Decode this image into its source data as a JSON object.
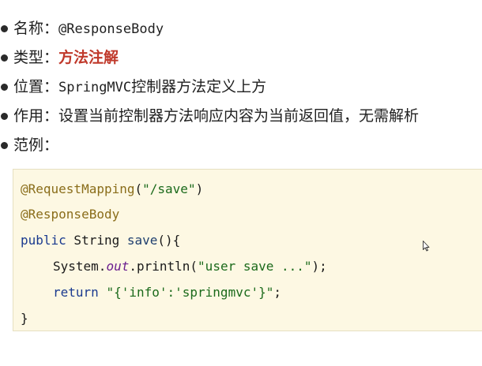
{
  "items": {
    "name": {
      "label": "名称：",
      "value": "@ResponseBody"
    },
    "type": {
      "label": "类型：",
      "value": "方法注解"
    },
    "position": {
      "label": "位置：",
      "value_code": "SpringMVC",
      "value_text": "控制器方法定义上方"
    },
    "usage": {
      "label": "作用：",
      "value": "设置当前控制器方法响应内容为当前返回值，无需解析"
    },
    "example": {
      "label": "范例："
    }
  },
  "code": {
    "line1_annotation": "@RequestMapping",
    "line1_open": "(",
    "line1_string": "\"/save\"",
    "line1_close": ")",
    "line2_annotation": "@ResponseBody",
    "line3_kw": "public",
    "line3_type": " String ",
    "line3_method": "save",
    "line3_rest": "(){",
    "line4_obj": "System.",
    "line4_field": "out",
    "line4_call": ".println(",
    "line4_string": "\"user save ...\"",
    "line4_end": ");",
    "line5_kw": "return",
    "line5_space": " ",
    "line5_string": "\"{'info':'springmvc'}\"",
    "line5_end": ";",
    "line6": "}"
  },
  "colors": {
    "accent": "#c0392b",
    "code_bg": "#fdf8e3"
  },
  "icons": {
    "cursor": "mouse-pointer-icon"
  }
}
